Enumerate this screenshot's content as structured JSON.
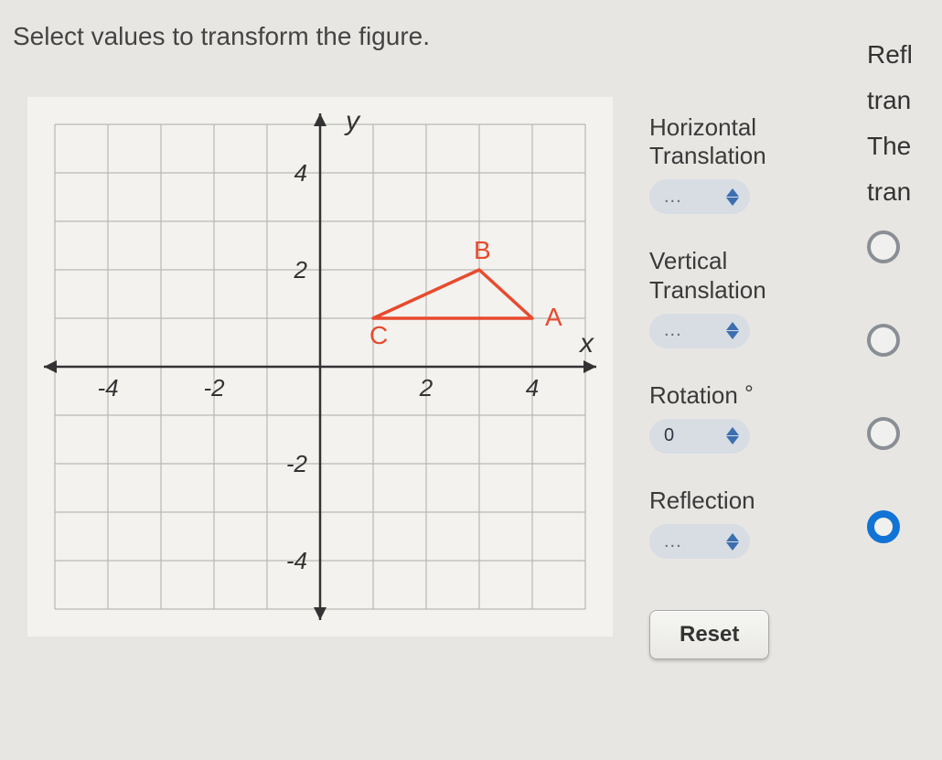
{
  "instruction": "Select values to transform the figure.",
  "chart_data": {
    "type": "scatter",
    "title": "",
    "xlabel": "x",
    "ylabel": "y",
    "xlim": [
      -5,
      5
    ],
    "ylim": [
      -5,
      5
    ],
    "x_ticks": [
      -4,
      -2,
      2,
      4
    ],
    "y_ticks": [
      -4,
      -2,
      2,
      4
    ],
    "shapes": [
      {
        "name": "triangle",
        "vertices": [
          {
            "label": "A",
            "x": 4,
            "y": 1
          },
          {
            "label": "B",
            "x": 3,
            "y": 2
          },
          {
            "label": "C",
            "x": 1,
            "y": 1
          }
        ],
        "stroke": "#e84a2e"
      }
    ]
  },
  "controls": {
    "horizontal": {
      "label": "Horizontal Translation",
      "value": "..."
    },
    "vertical": {
      "label": "Vertical Translation",
      "value": "..."
    },
    "rotation": {
      "label": "Rotation",
      "value": "0",
      "unit": "°"
    },
    "reflection": {
      "label": "Reflection",
      "value": "..."
    },
    "reset": "Reset"
  },
  "right_partial": {
    "line1": "Refl",
    "line2": "tran",
    "line3": "The",
    "line4": "tran",
    "radio_selected_index": 3
  }
}
